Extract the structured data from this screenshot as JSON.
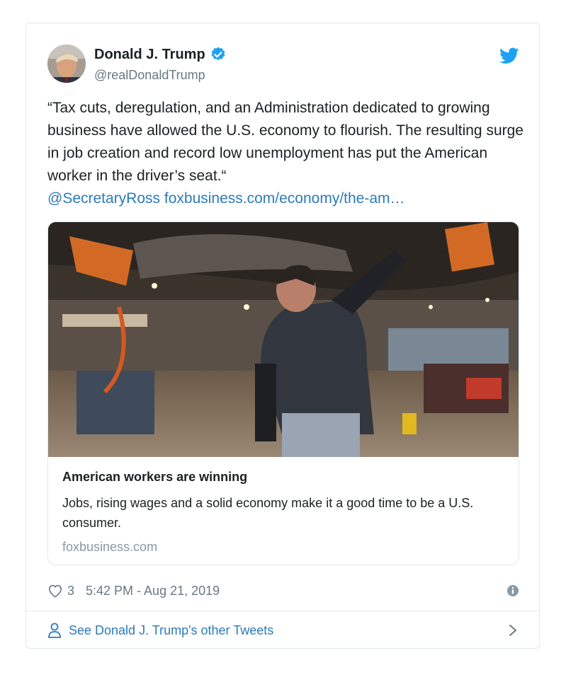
{
  "author": {
    "display_name": "Donald J. Trump",
    "handle": "@realDonaldTrump",
    "verified": true
  },
  "tweet": {
    "text": "“Tax cuts, deregulation, and an Administration dedicated to growing business have allowed the U.S. economy to flourish. The resulting surge in job creation and record low unemployment has put the American worker in the driver’s seat.“",
    "mention": "@SecretaryRoss",
    "link": "foxbusiness.com/economy/the-am…"
  },
  "link_card": {
    "title": "American workers are winning",
    "description": "Jobs, rising wages and a solid economy make it a good time to be a U.S. consumer.",
    "domain": "foxbusiness.com"
  },
  "footer": {
    "like_count": "3",
    "timestamp": "5:42 PM - Aug 21, 2019"
  },
  "other_tweets_label": "See Donald J. Trump's other Tweets",
  "icons": {
    "verified": "verified-badge-icon",
    "twitter": "twitter-bird-icon",
    "like": "heart-icon",
    "info": "info-icon",
    "person": "person-icon",
    "chevron": "chevron-right-icon"
  },
  "colors": {
    "accent": "#1da1f2",
    "link": "#2b7bb9",
    "muted": "#697882",
    "border": "#e1e8ed"
  }
}
